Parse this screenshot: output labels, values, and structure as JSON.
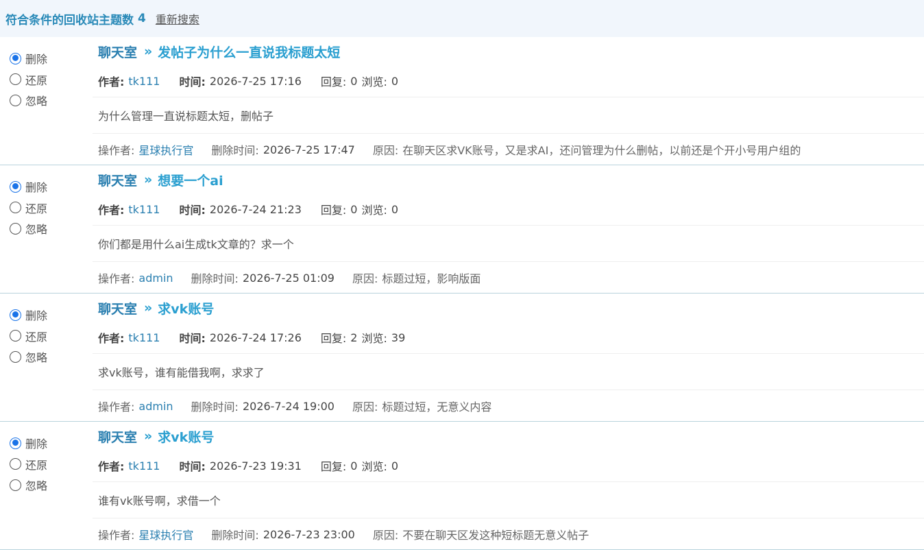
{
  "header": {
    "count_label": "符合条件的回收站主题数",
    "count_value": "4",
    "research_label": "重新搜索"
  },
  "labels": {
    "delete": "删除",
    "restore": "还原",
    "ignore": "忽略",
    "arrow": "»",
    "author": "作者:",
    "time": "时间:",
    "replies": "回复:",
    "views": "浏览:",
    "operator": "操作者:",
    "delete_time": "删除时间:",
    "reason": "原因:"
  },
  "items": [
    {
      "forum": "聊天室",
      "title": "发帖子为什么一直说我标题太短",
      "author": "tk111",
      "time": "2026-7-25 17:16",
      "replies": "0",
      "views": "0",
      "body": "为什么管理一直说标题太短，删帖子",
      "operator": "星球执行官",
      "delete_time": "2026-7-25 17:47",
      "reason": "在聊天区求VK账号，又是求AI，还问管理为什么删帖，以前还是个开小号用户组的",
      "selected": "delete"
    },
    {
      "forum": "聊天室",
      "title": "想要一个ai",
      "author": "tk111",
      "time": "2026-7-24 21:23",
      "replies": "0",
      "views": "0",
      "body": "你们都是用什么ai生成tk文章的？求一个",
      "operator": "admin",
      "delete_time": "2026-7-25 01:09",
      "reason": "标题过短，影响版面",
      "selected": "delete"
    },
    {
      "forum": "聊天室",
      "title": "求vk账号",
      "author": "tk111",
      "time": "2026-7-24 17:26",
      "replies": "2",
      "views": "39",
      "body": "求vk账号，谁有能借我啊，求求了",
      "operator": "admin",
      "delete_time": "2026-7-24 19:00",
      "reason": "标题过短，无意义内容",
      "selected": "delete"
    },
    {
      "forum": "聊天室",
      "title": "求vk账号",
      "author": "tk111",
      "time": "2026-7-23 19:31",
      "replies": "0",
      "views": "0",
      "body": "谁有vk账号啊，求借一个",
      "operator": "星球执行官",
      "delete_time": "2026-7-23 23:00",
      "reason": "不要在聊天区发这种短标题无意义帖子",
      "selected": "delete"
    }
  ]
}
